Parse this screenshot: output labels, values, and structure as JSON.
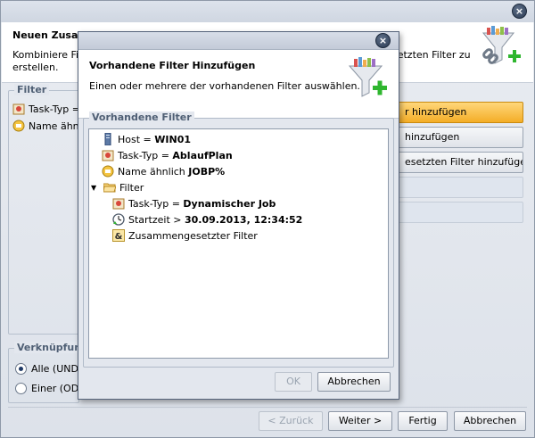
{
  "wizard": {
    "title": "Neuen Zusammengesetzten Filter erstellen",
    "title_visible": "Neuen Zusam",
    "description_line1": "Kombiniere Filte",
    "description_line1_right": "setzten Filter zu",
    "description_line2": "erstellen.",
    "filter_group_label": "Filter",
    "filter_items": [
      {
        "label": "Task-Typ =",
        "icon": "task-type-icon"
      },
      {
        "label": "Name ähnlic",
        "icon": "name-filter-icon"
      }
    ],
    "side_buttons": [
      {
        "label": "r hinzufügen",
        "style": "primary"
      },
      {
        "label": "hinzufügen",
        "style": "normal"
      },
      {
        "label": "esetzten Filter hinzufügen",
        "style": "normal"
      },
      {
        "label": "",
        "style": "disabled"
      },
      {
        "label": "",
        "style": "disabled"
      }
    ],
    "link_group_label": "Verknüpfung",
    "radio_all": "Alle (UND)",
    "radio_one": "Einer (ODE",
    "radio_selected": "all",
    "footer": {
      "back": "< Zurück",
      "next": "Weiter >",
      "finish": "Fertig",
      "cancel": "Abbrechen"
    }
  },
  "dialog": {
    "heading": "Vorhandene Filter Hinzufügen",
    "description": "Einen oder mehrere der vorhandenen Filter auswählen.",
    "group_label": "Vorhandene Filter",
    "tree": {
      "host_label": "Host = ",
      "host_value": "WIN01",
      "task_label": "Task-Typ = ",
      "task_value": "AblaufPlan",
      "name_label": "Name ähnlich ",
      "name_value": "JOBP%",
      "folder_label": "Filter",
      "sub_task_label": "Task-Typ = ",
      "sub_task_value": "Dynamischer Job",
      "start_label": "Startzeit > ",
      "start_value": "30.09.2013, 12:34:52",
      "combined_label": "Zusammengesetzter Filter"
    },
    "ok_label": "OK",
    "cancel_label": "Abbrechen"
  },
  "colors": {
    "accent_orange": "#f4ad27",
    "dialog_border": "#55637a",
    "green_plus": "#2fb62f"
  }
}
